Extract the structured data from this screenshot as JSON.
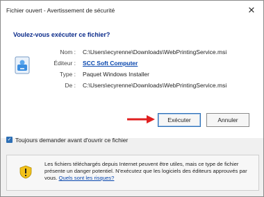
{
  "window": {
    "title": "Fichier ouvert - Avertissement de sécurité",
    "close_glyph": "✕"
  },
  "question": "Voulez-vous exécuter ce fichier?",
  "file_icon": "installer-file-icon",
  "properties": [
    {
      "label": "Nom :",
      "value": "C:\\Users\\ecyrenne\\Downloads\\WebPrintingService.msi",
      "is_link": false
    },
    {
      "label": "Éditeur :",
      "value": "SCC Soft Computer",
      "is_link": true
    },
    {
      "label": "Type :",
      "value": "Paquet Windows Installer",
      "is_link": false
    },
    {
      "label": "De :",
      "value": "C:\\Users\\ecyrenne\\Downloads\\WebPrintingService.msi",
      "is_link": false
    }
  ],
  "buttons": {
    "run": "Exécuter",
    "cancel": "Annuler"
  },
  "checkbox": {
    "label": "Toujours demander avant d'ouvrir ce fichier",
    "checked": true
  },
  "info": {
    "text": "Les fichiers téléchargés depuis Internet peuvent être utiles, mais ce type de fichier présente un danger potentiel. N'exécutez que les logiciels des éditeurs approuvés par vous.",
    "link": "Quels sont les risques?"
  },
  "colors": {
    "accent": "#2d6fb5",
    "link": "#0645ad",
    "arrow": "#e02020",
    "shield_yellow": "#f3c21b"
  }
}
